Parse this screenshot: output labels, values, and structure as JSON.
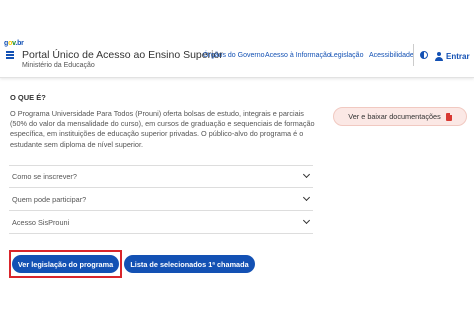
{
  "header": {
    "logo_text": "gov.br",
    "site_title": "Portal Único de Acesso ao Ensino Superior",
    "site_subtitle": "Ministério da Educação",
    "nav": [
      {
        "label": "Órgãos do Governo"
      },
      {
        "label": "Acesso à Informação"
      },
      {
        "label": "Legislação"
      },
      {
        "label": "Acessibilidade"
      }
    ],
    "login_label": "Entrar"
  },
  "main": {
    "section_title": "O QUE É?",
    "intro": "O Programa Universidade Para Todos (Prouni) oferta bolsas de estudo, integrais e parciais (50% do valor da mensalidade do curso), em cursos de graduação e sequenciais de formação específica, em instituições de educação superior privadas. O público-alvo do programa é o estudante sem diploma de nível superior.",
    "doc_button": "Ver e baixar documentações",
    "accordion": [
      {
        "label": "Como se inscrever?"
      },
      {
        "label": "Quem pode participar?"
      },
      {
        "label": "Acesso SisProuni"
      }
    ],
    "buttons": {
      "legislation": "Ver legislação do programa",
      "selected_list": "Lista de selecionados 1ª chamada"
    }
  },
  "colors": {
    "primary": "#1351b4",
    "highlight": "#d9252b",
    "doc_button_bg": "#fbe8e5"
  }
}
